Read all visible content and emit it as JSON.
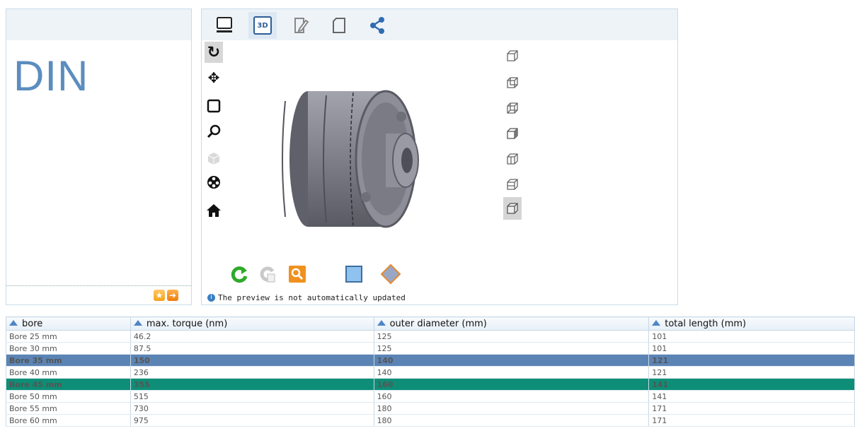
{
  "sidebar": {
    "title": "DIN"
  },
  "viewer": {
    "tabs": [
      {
        "icon": "monitor-icon"
      },
      {
        "label": "3D",
        "icon": "3d-icon"
      },
      {
        "icon": "edit-document-icon"
      },
      {
        "icon": "blank-document-icon"
      },
      {
        "icon": "share-icon"
      }
    ],
    "tools": [
      "rotate-icon",
      "pan-icon",
      "zoom-window-icon",
      "zoom-icon",
      "shade-cube-icon",
      "orbit-reel-icon",
      "home-icon"
    ],
    "view_buttons": [
      "view-front-icon",
      "view-back-icon",
      "view-left-icon",
      "view-right-icon",
      "view-top-icon",
      "view-bottom-icon",
      "view-iso-icon"
    ],
    "preview_note": "The preview is not automatically updated",
    "colors": {
      "accent": "#5b8dbf",
      "refresh": "#2faa2a",
      "orange": "#f0901e"
    }
  },
  "table": {
    "columns": [
      "bore",
      "max. torque (nm)",
      "outer diameter (mm)",
      "total length (mm)"
    ],
    "rows": [
      [
        "Bore 25 mm",
        "46.2",
        "125",
        "101"
      ],
      [
        "Bore 30 mm",
        "87.5",
        "125",
        "101"
      ],
      [
        "Bore 35 mm",
        "150",
        "140",
        "121"
      ],
      [
        "Bore 40 mm",
        "236",
        "140",
        "121"
      ],
      [
        "Bore 45 mm",
        "355",
        "160",
        "141"
      ],
      [
        "Bore 50 mm",
        "515",
        "160",
        "141"
      ],
      [
        "Bore 55 mm",
        "730",
        "180",
        "171"
      ],
      [
        "Bore 60 mm",
        "975",
        "180",
        "171"
      ]
    ],
    "selected_blue_row": 2,
    "selected_green_row": 4,
    "colors": {
      "blue": "#5b84b5",
      "green": "#0e8e76"
    }
  }
}
